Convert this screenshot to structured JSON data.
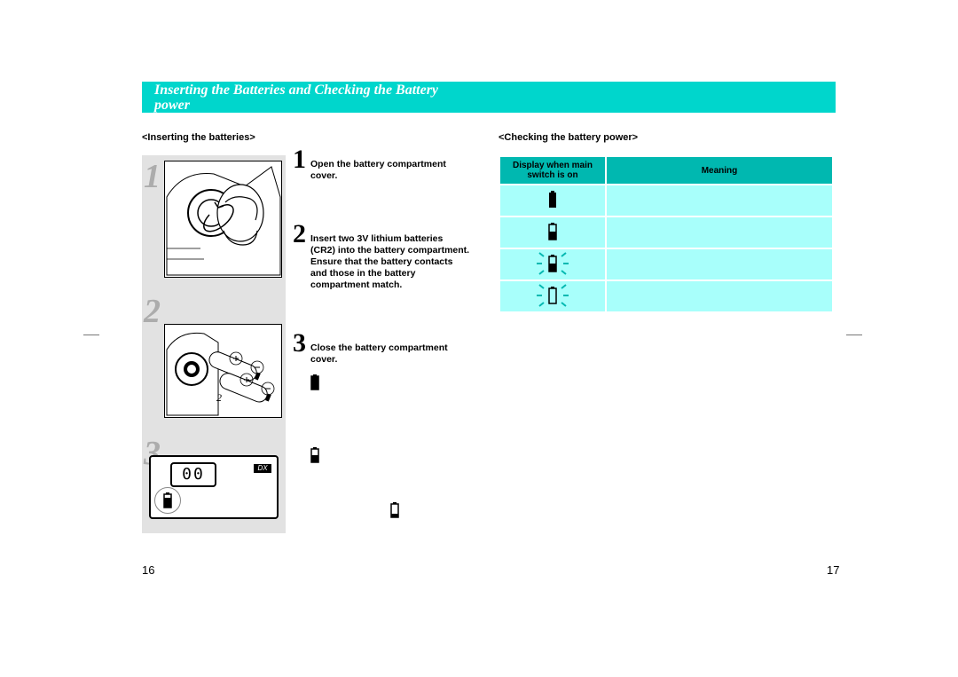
{
  "header": {
    "line1": "Inserting the Batteries and Checking the Battery",
    "line2": "power"
  },
  "left": {
    "subheading": "<Inserting the batteries>",
    "big_numbers": [
      "1",
      "2",
      "3"
    ],
    "page_number": "16",
    "lcd": "00",
    "dx": "DX"
  },
  "steps": {
    "s1": {
      "num": "1",
      "text": "Open the battery compartment cover."
    },
    "s2": {
      "num": "2",
      "text": "Insert two 3V lithium batteries (CR2) into the battery compartment. Ensure that the battery contacts and those in the battery compartment match."
    },
    "s3": {
      "num": "3",
      "text": "Close the battery compartment cover."
    }
  },
  "right": {
    "subheading": "<Checking the battery power>",
    "th_display": "Display when main switch is on",
    "th_meaning": "Meaning",
    "page_number": "17",
    "rows": [
      {
        "meaning": ""
      },
      {
        "meaning": ""
      },
      {
        "meaning": ""
      },
      {
        "meaning": ""
      }
    ]
  }
}
